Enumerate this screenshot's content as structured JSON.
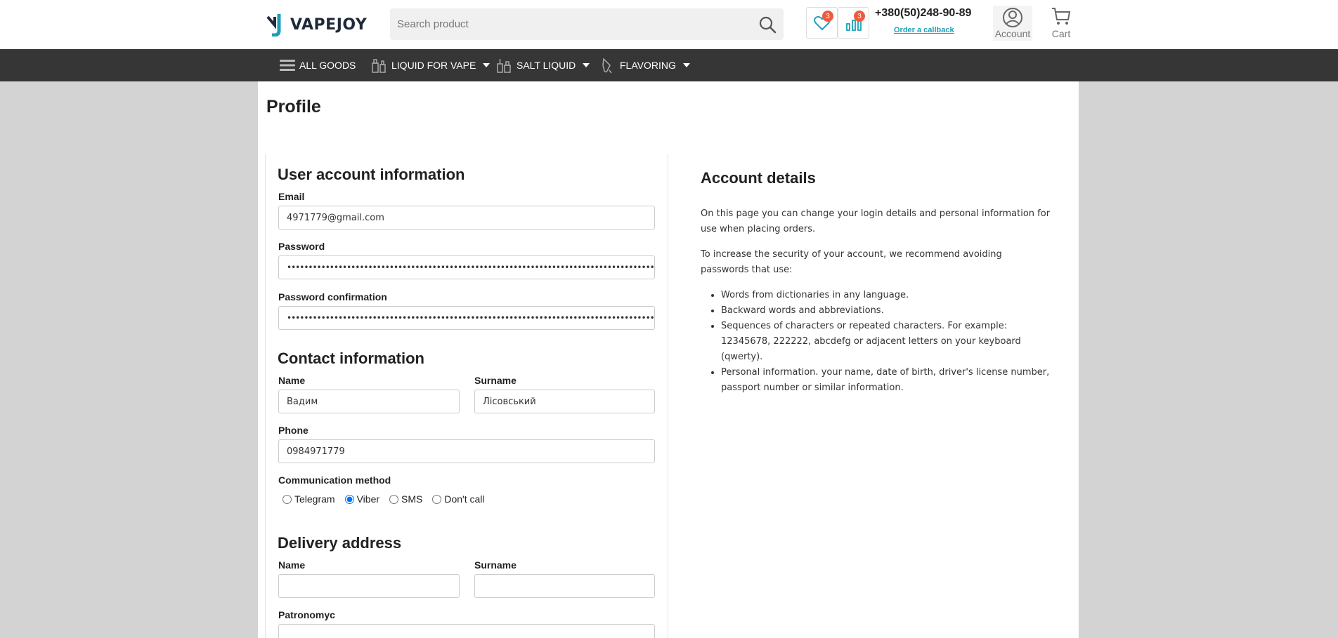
{
  "header": {
    "logo_text": "VAPEJOY",
    "search_placeholder": "Search product",
    "wishlist_count": "3",
    "compare_count": "3",
    "phone": "+380(50)248-90-89",
    "callback_label": "Order a callback",
    "account_label": "Account",
    "cart_label": "Cart"
  },
  "nav": {
    "all_goods": "ALL GOODS",
    "liquid_for_vape": "LIQUID FOR VAPE",
    "salt_liquid": "SALT LIQUID",
    "flavoring": "FLAVORING"
  },
  "page": {
    "title": "Profile"
  },
  "user_account": {
    "title": "User account information",
    "email_label": "Email",
    "email_value": "4971779@gmail.com",
    "password_label": "Password",
    "password_value": "••••••••••••••••••••••••••••••••••••••••••••••••••••••••••••••••••••••••••••••••••••••••••••",
    "password_confirm_label": "Password confirmation",
    "password_confirm_value": "••••••••••••••••••••••••••••••••••••••••••••••••••••••••••••••••••••••••••••••••••••••••••••"
  },
  "contact": {
    "title": "Contact information",
    "name_label": "Name",
    "name_value": "Вадим",
    "surname_label": "Surname",
    "surname_value": "Лісовський",
    "phone_label": "Phone",
    "phone_value": "0984971779",
    "method_label": "Communication method",
    "methods": [
      "Telegram",
      "Viber",
      "SMS",
      "Don't call"
    ],
    "selected_method": "Viber"
  },
  "delivery": {
    "title": "Delivery address",
    "name_label": "Name",
    "surname_label": "Surname",
    "patronymic_label": "Patronomyc"
  },
  "account_details": {
    "title": "Account details",
    "para1": "On this page you can change your login details and personal information for use when placing orders.",
    "para2": "To increase the security of your account, we recommend avoiding passwords that use:",
    "items": [
      "Words from dictionaries in any language.",
      "Backward words and abbreviations.",
      "Sequences of characters or repeated characters. For example: 12345678, 222222, abcdefg or adjacent letters on your keyboard (qwerty).",
      "Personal information. your name, date of birth, driver's license number, passport number or similar information."
    ]
  },
  "colors": {
    "accent": "#1aa0b8",
    "badge": "#ef5a3c",
    "navbar": "#363636",
    "background": "#d3d3d3"
  }
}
